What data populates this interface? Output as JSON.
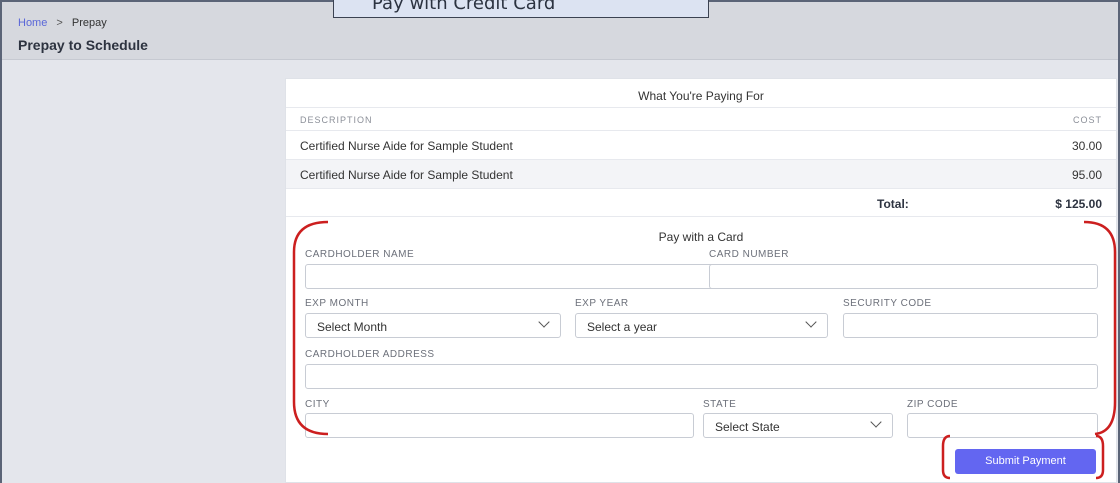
{
  "header": {
    "breadcrumb": {
      "home": "Home",
      "separator": ">",
      "current": "Prepay"
    },
    "title": "Prepay to Schedule"
  },
  "callout": {
    "text": "Pay with Credit Card"
  },
  "summary": {
    "title": "What You're Paying For",
    "columns": {
      "description": "DESCRIPTION",
      "cost": "COST"
    },
    "rows": [
      {
        "description": "Certified Nurse Aide for Sample Student",
        "cost": "30.00"
      },
      {
        "description": "Certified Nurse Aide for Sample Student",
        "cost": "95.00"
      }
    ],
    "total_label": "Total:",
    "total_value": "$ 125.00"
  },
  "payment_form": {
    "title": "Pay with a Card",
    "cardholder_name_label": "CARDHOLDER NAME",
    "card_number_label": "CARD NUMBER",
    "exp_month_label": "EXP MONTH",
    "exp_month_value": "Select Month",
    "exp_year_label": "EXP YEAR",
    "exp_year_value": "Select a year",
    "security_code_label": "SECURITY CODE",
    "address_label": "CARDHOLDER ADDRESS",
    "city_label": "CITY",
    "state_label": "STATE",
    "state_value": "Select State",
    "zip_label": "ZIP CODE",
    "submit_label": "Submit Payment"
  },
  "colors": {
    "accent": "#6366f1",
    "link": "#5a67d8",
    "annotation": "#cc1f1f",
    "header_bg": "#d6d8de",
    "page_bg": "#e4e6ec"
  }
}
